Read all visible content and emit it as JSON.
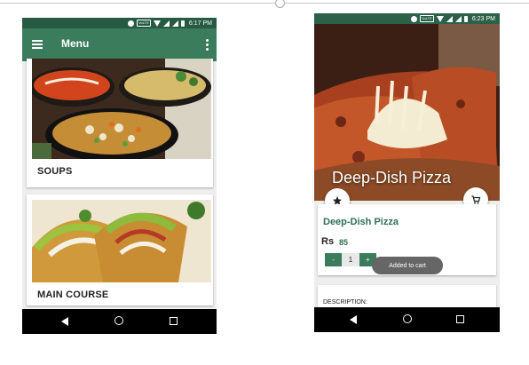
{
  "left_screen": {
    "status_time": "6:17 PM",
    "status_volte": "VoLTE",
    "appbar": {
      "title": "Menu"
    },
    "categories": [
      {
        "label": "SOUPS"
      },
      {
        "label": "MAIN COURSE"
      }
    ]
  },
  "right_screen": {
    "status_time": "6:23 PM",
    "status_volte": "VoLTE",
    "hero_title": "Deep-Dish Pizza",
    "item": {
      "name": "Deep-Dish Pizza",
      "currency": "Rs",
      "price": "85",
      "stepper": {
        "minus": "-",
        "quantity": "1",
        "plus": "+"
      }
    },
    "toast": "Added to cart",
    "description_label": "DESCRIPTION:"
  },
  "colors": {
    "status_bar": "#265a43",
    "app_bar": "#3a7c5c",
    "accent_text": "#2f6f54",
    "toast": "#666666",
    "nav_bar": "#000000"
  },
  "icons": [
    "hamburger-menu-icon",
    "overflow-menu-icon",
    "star-icon",
    "cart-icon",
    "back-icon",
    "home-icon",
    "recents-icon"
  ]
}
